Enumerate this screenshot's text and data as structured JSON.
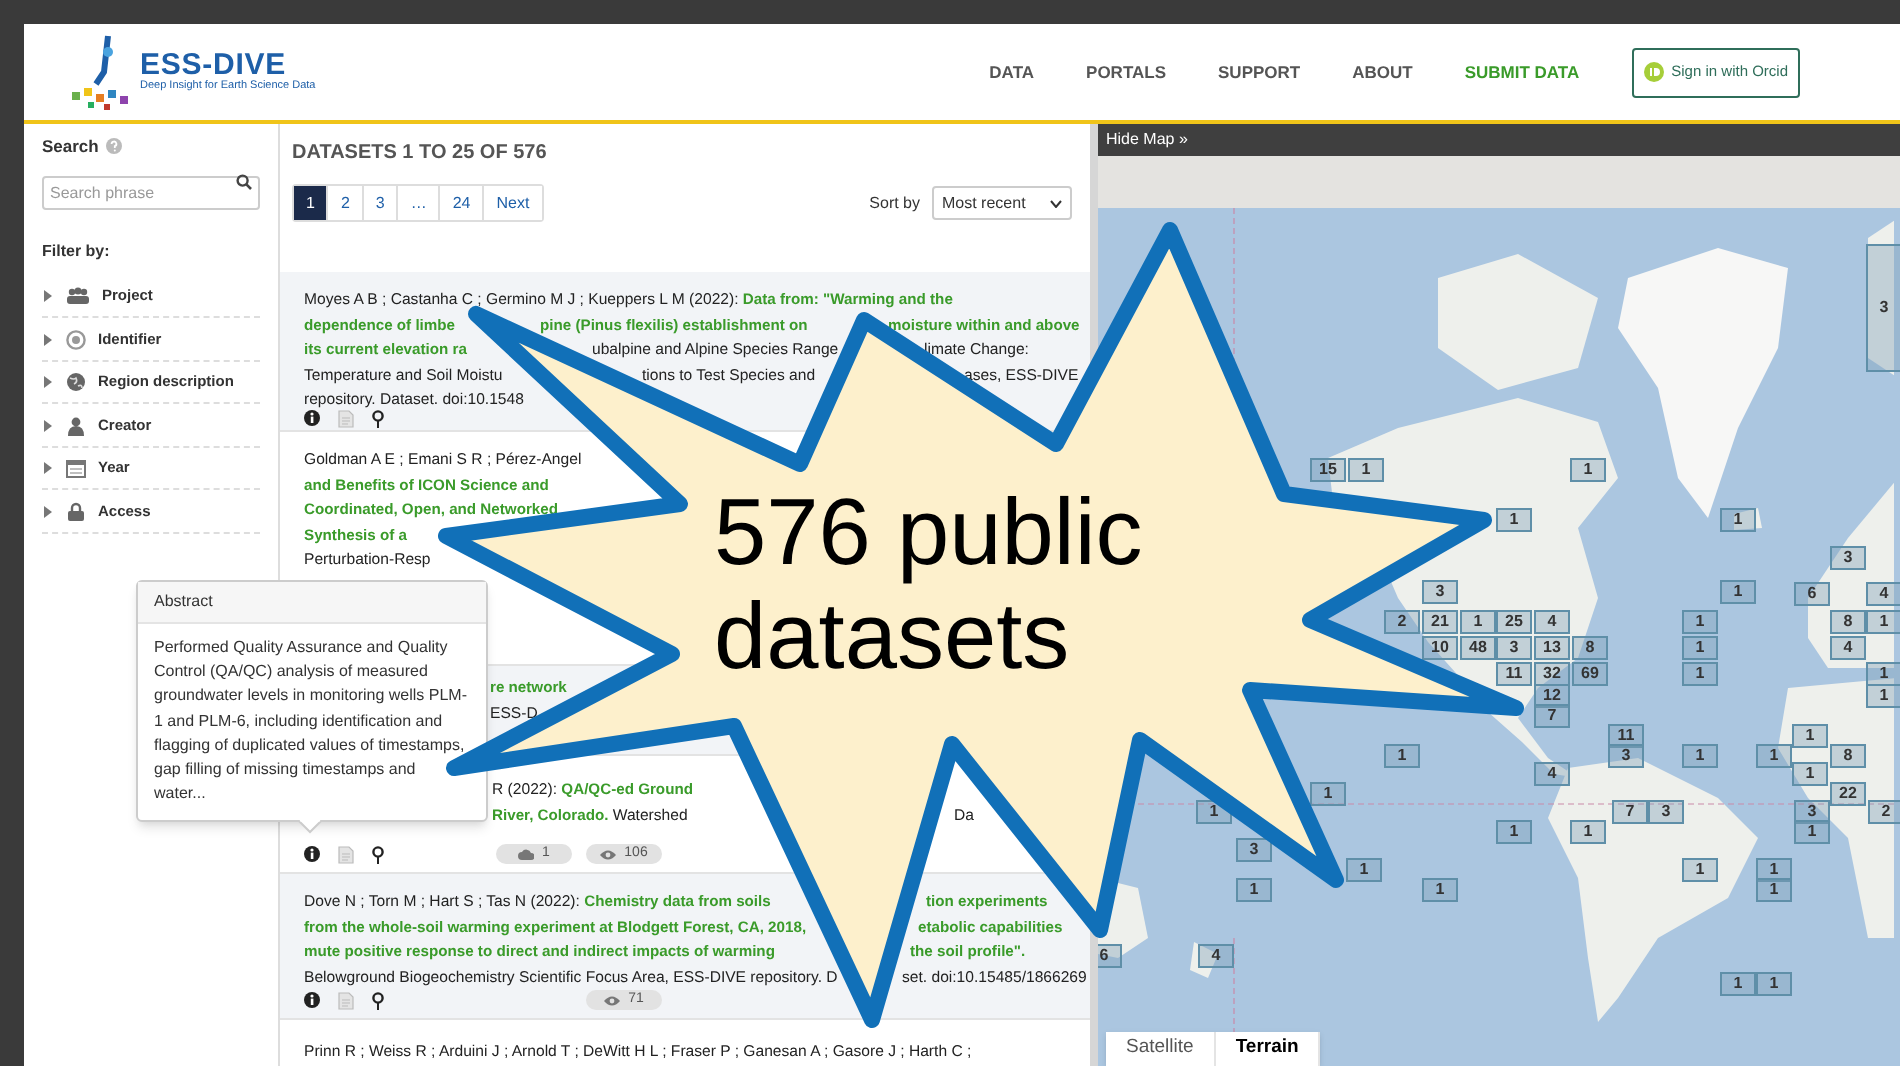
{
  "header": {
    "logo_title": "ESS-DIVE",
    "logo_tagline": "Deep Insight for Earth Science Data",
    "nav": [
      {
        "label": "DATA",
        "highlighted": false
      },
      {
        "label": "PORTALS",
        "highlighted": false
      },
      {
        "label": "SUPPORT",
        "highlighted": false
      },
      {
        "label": "ABOUT",
        "highlighted": false
      },
      {
        "label": "SUBMIT DATA",
        "highlighted": true
      }
    ],
    "sign_in": "Sign in with Orcid"
  },
  "sidebar": {
    "search_label": "Search",
    "search_placeholder": "Search phrase",
    "filter_heading": "Filter by:",
    "filters": [
      {
        "label": "Project",
        "expanded": false
      },
      {
        "label": "Identifier",
        "expanded": false
      },
      {
        "label": "Region description",
        "expanded": false
      },
      {
        "label": "Creator",
        "expanded": false
      },
      {
        "label": "Year",
        "expanded": false
      },
      {
        "label": "Access",
        "expanded": false
      }
    ]
  },
  "results": {
    "heading": "DATASETS 1 TO 25 OF 576",
    "pages": [
      {
        "label": "1",
        "selected": true
      },
      {
        "label": "2",
        "selected": false
      },
      {
        "label": "3",
        "selected": false
      },
      {
        "label": "…",
        "selected": false
      },
      {
        "label": "24",
        "selected": false
      },
      {
        "label": "Next",
        "selected": false
      }
    ],
    "sort_label": "Sort by",
    "sort_value": "Most recent",
    "records": [
      {
        "has_icons": true,
        "lines": [
          [
            [
              {
                "text": "Moyes A B ; Castanha C ; Germino M J ; Kueppers L M (2022): ",
                "link": false
              },
              {
                "text": "Data from: \"Warming and the",
                "link": true
              }
            ]
          ],
          [
            [
              {
                "text": "dependence of limbe",
                "link": true
              }
            ],
            [
              {
                "text": "pine (Pinus flexilis) establishment on",
                "link": true
              }
            ],
            [
              {
                "text": "moisture within and above",
                "link": true
              }
            ]
          ],
          [
            [
              {
                "text": "its current elevation ra",
                "link": true
              }
            ],
            [
              {
                "text": "ubalpine and Alpine Species Range",
                "link": false
              }
            ],
            [
              {
                "text": "limate Change:",
                "link": false
              }
            ]
          ],
          [
            [
              {
                "text": "Temperature and Soil Moistu",
                "link": false
              }
            ],
            [
              {
                "text": "tions to Test Species and",
                "link": false
              }
            ],
            [
              {
                "text": "ases, ESS-DIVE",
                "link": false
              }
            ]
          ],
          [
            [
              {
                "text": "repository. Dataset. doi:10.1548",
                "link": false
              }
            ]
          ]
        ]
      },
      {
        "has_icons": false,
        "lines": [
          [
            [
              {
                "text": "Goldman A E ; Emani S R ; Pérez-Angel",
                "link": false
              }
            ]
          ],
          [
            [
              {
                "text": "and Benefits of ICON Science and",
                "link": true
              }
            ]
          ],
          [
            [
              {
                "text": "Coordinated, Open, and Networked",
                "link": true
              }
            ]
          ],
          [
            [
              {
                "text": "Synthesis of a",
                "link": true
              }
            ]
          ],
          [
            [
              {
                "text": "Perturbation-Resp",
                "link": false
              }
            ]
          ]
        ]
      },
      {
        "has_icons": false,
        "lines": [
          [
            [
              {
                "text": "re network",
                "link": true
              }
            ]
          ],
          [
            [
              {
                "text": "ESS-D",
                "link": false
              }
            ]
          ]
        ]
      },
      {
        "has_icons": true,
        "badges": [
          {
            "kind": "downloads",
            "text": "1"
          },
          {
            "kind": "views",
            "text": "106"
          }
        ],
        "lines": [
          [
            [
              {
                "text": "R (2022): ",
                "link": false
              },
              {
                "text": "QA/QC-ed Ground",
                "link": true
              }
            ]
          ],
          [
            [
              {
                "text": "River, Colorado.",
                "link": true
              },
              {
                "text": " Watershed",
                "link": false
              }
            ],
            [
              {
                "text": "Da",
                "link": false
              }
            ]
          ]
        ]
      },
      {
        "has_icons": true,
        "badges": [
          {
            "kind": "views",
            "text": "71"
          }
        ],
        "lines": [
          [
            [
              {
                "text": "Dove N ; Torn M ; Hart S ; Tas N (2022): ",
                "link": false
              },
              {
                "text": "Chemistry data from soils",
                "link": true
              }
            ],
            [
              {
                "text": "tion experiments",
                "link": true
              }
            ]
          ],
          [
            [
              {
                "text": "from the whole-soil warming experiment at Blodgett Forest, CA, 2018,",
                "link": true
              }
            ],
            [
              {
                "text": "etabolic capabilities",
                "link": true
              }
            ]
          ],
          [
            [
              {
                "text": "mute positive response to direct and indirect impacts of warming",
                "link": true
              }
            ],
            [
              {
                "text": "the soil profile\".",
                "link": true
              }
            ]
          ],
          [
            [
              {
                "text": "Belowground Biogeochemistry Scientific Focus Area, ESS-DIVE repository. D",
                "link": false
              }
            ],
            [
              {
                "text": "set. doi:10.15485/1866269",
                "link": false
              }
            ]
          ]
        ]
      },
      {
        "lines": [
          [
            [
              {
                "text": "Prinn R ; Weiss R ; Arduini J ; Arnold T ; DeWitt H L ; Fraser P ; Ganesan A ; Gasore J ; Harth C ;",
                "link": false
              }
            ]
          ]
        ]
      }
    ],
    "abstract_popover": {
      "title": "Abstract",
      "text": "Performed Quality Assurance and Quality Control (QA/QC) analysis of measured groundwater levels in monitoring wells PLM-1 and PLM-6, including identification and flagging of duplicated values of timestamps, gap filling of missing timestamps and water..."
    }
  },
  "map": {
    "toggle": "Hide Map »",
    "markers": [
      "3",
      "15",
      "1",
      "1",
      "1",
      "1",
      "3",
      "3",
      "1",
      "6",
      "4",
      "2",
      "21",
      "1",
      "25",
      "4",
      "1",
      "8",
      "1",
      "10",
      "48",
      "3",
      "13",
      "8",
      "1",
      "4",
      "11",
      "32",
      "69",
      "1",
      "1",
      "12",
      "1",
      "7",
      "11",
      "1",
      "1",
      "3",
      "1",
      "1",
      "8",
      "4",
      "1",
      "1",
      "22",
      "1",
      "7",
      "3",
      "3",
      "2",
      "1",
      "1",
      "1",
      "3",
      "1",
      "1",
      "1",
      "1",
      "1",
      "1",
      "6",
      "4",
      "1",
      "1"
    ],
    "tabs": [
      {
        "label": "Satellite",
        "selected": false
      },
      {
        "label": "Terrain",
        "selected": true
      }
    ]
  },
  "callout": {
    "lines": [
      "576 public",
      "datasets"
    ]
  }
}
